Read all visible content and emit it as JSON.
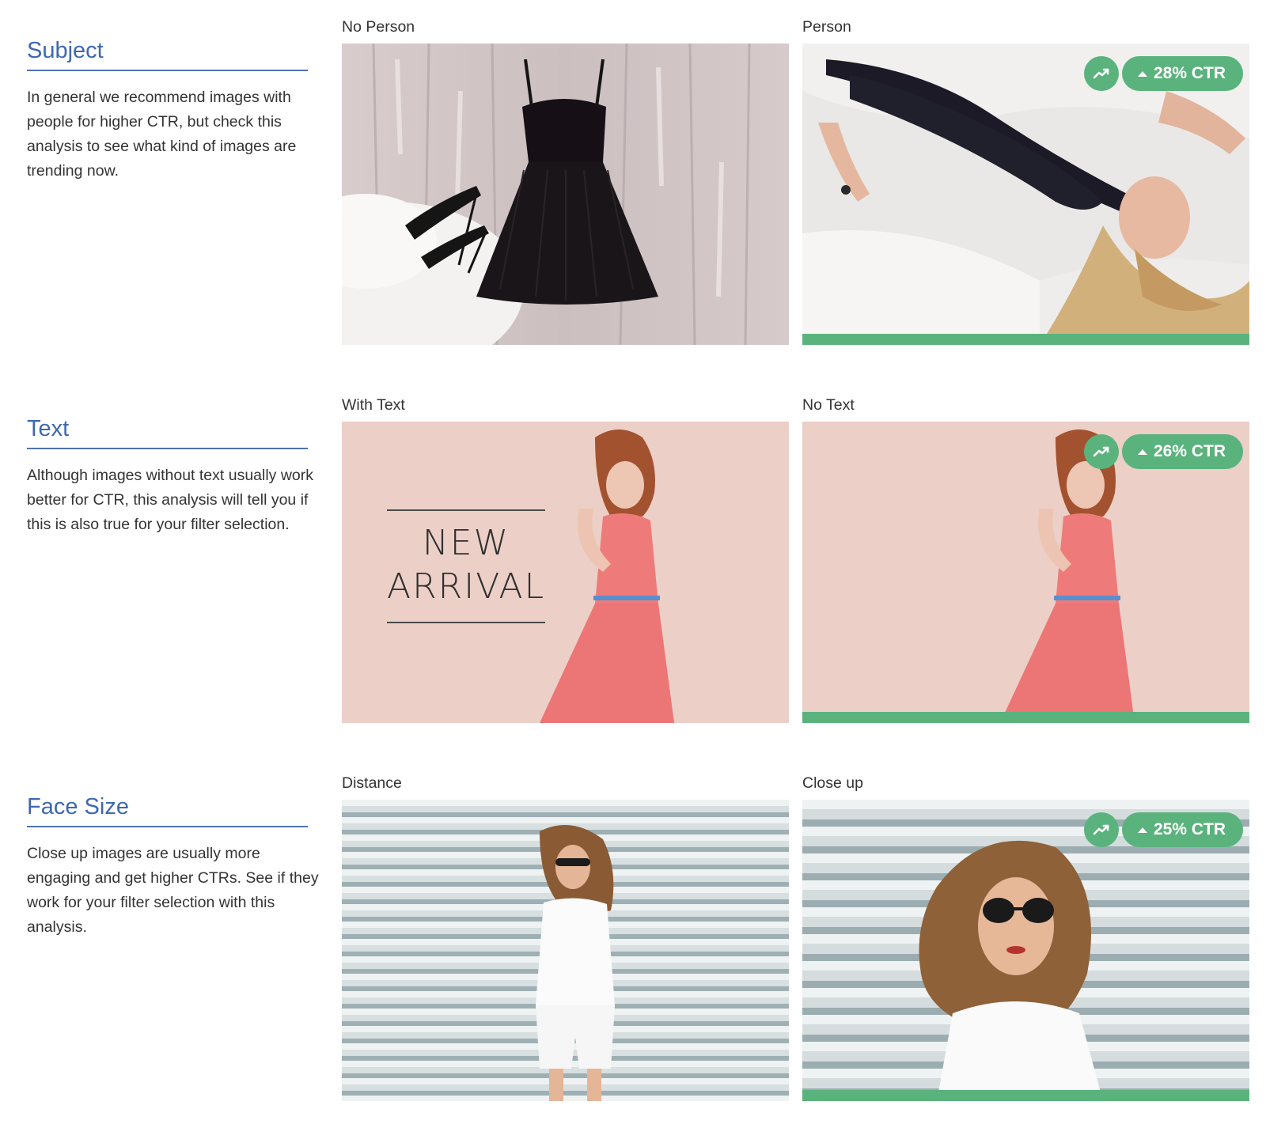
{
  "colors": {
    "accent": "#5ab37d",
    "title": "#3d68b0"
  },
  "sections": [
    {
      "title": "Subject",
      "description": "In general we recommend images with people for higher CTR, but check this analysis to see what kind of images are trending now.",
      "left": {
        "label": "No Person"
      },
      "right": {
        "label": "Person",
        "badge": "28% CTR",
        "icon": "trending-up-icon"
      }
    },
    {
      "title": "Text",
      "description": "Although images without text usually work better for CTR, this analysis will tell you if this is also true for your filter selection.",
      "left": {
        "label": "With Text",
        "overlay_line1": "NEW",
        "overlay_line2": "ARRIVAL"
      },
      "right": {
        "label": "No Text",
        "badge": "26% CTR",
        "icon": "trending-up-icon"
      }
    },
    {
      "title": "Face Size",
      "description": "Close up images are usually more engaging and get higher CTRs. See if they work for your filter selection with this analysis.",
      "left": {
        "label": "Distance"
      },
      "right": {
        "label": "Close up",
        "badge": "25% CTR",
        "icon": "trending-up-icon"
      }
    }
  ]
}
